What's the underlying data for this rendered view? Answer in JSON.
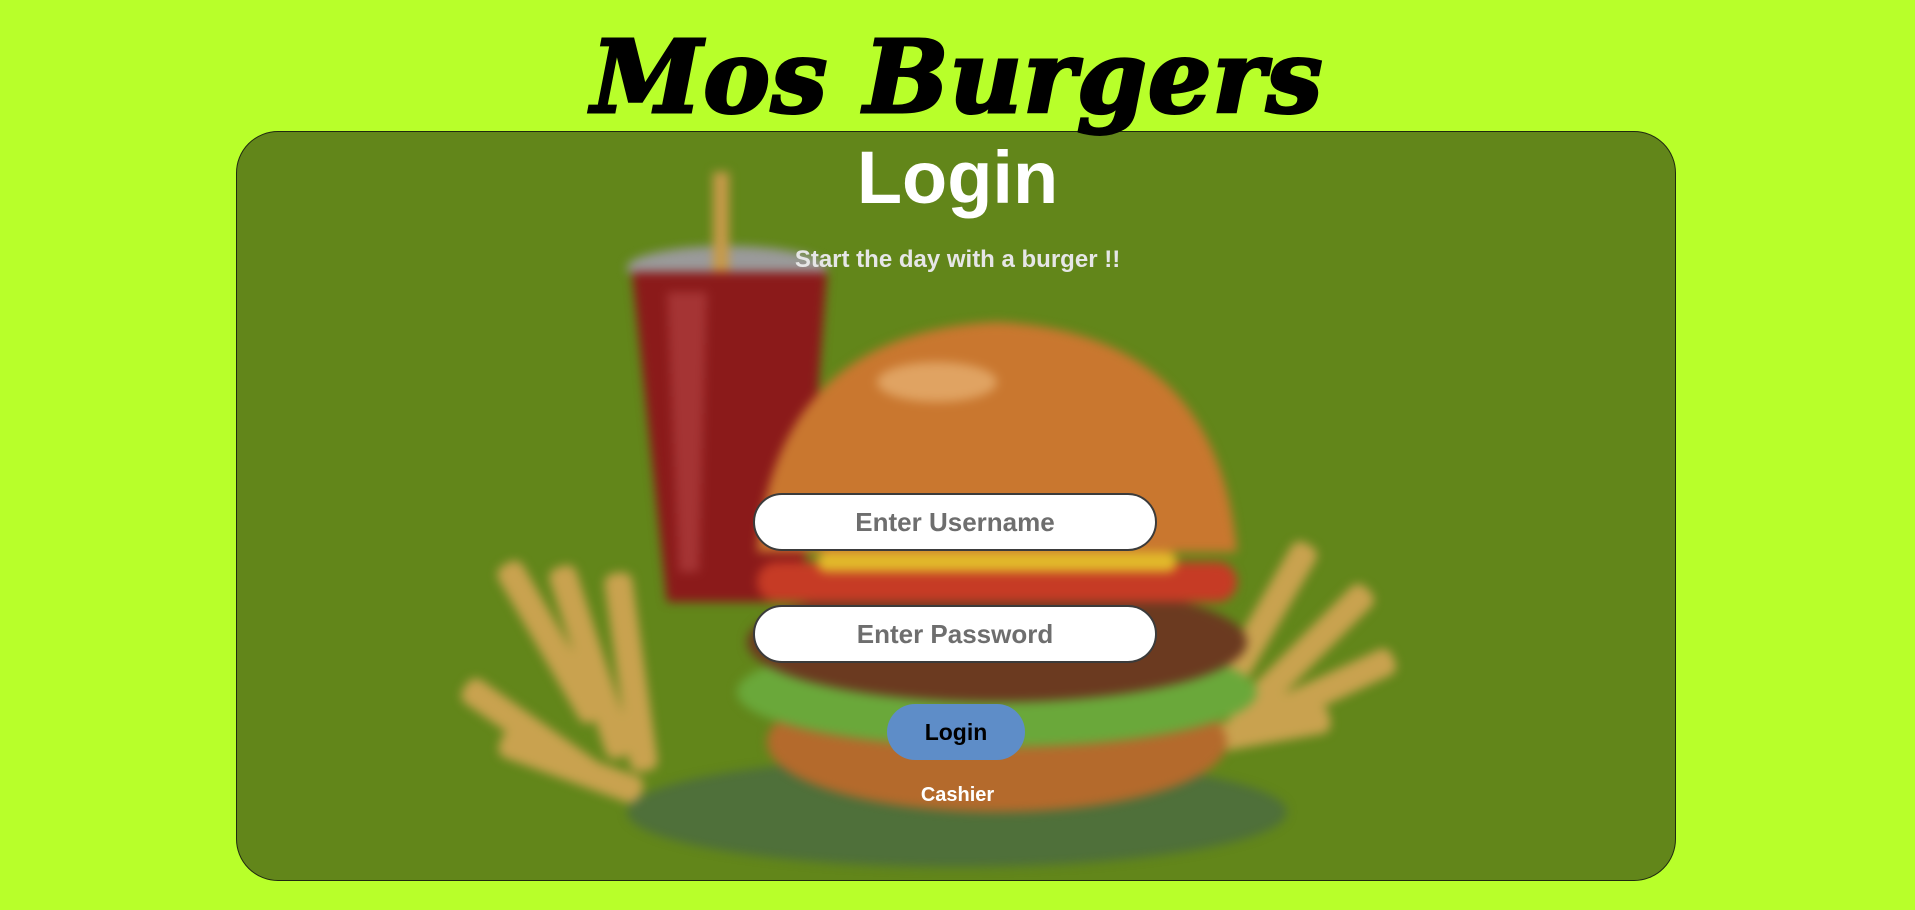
{
  "brand": {
    "name": "Mos Burgers"
  },
  "login": {
    "title": "Login",
    "subtitle": "Start the day with a burger !!",
    "username_placeholder": "Enter Username",
    "password_placeholder": "Enter Password",
    "submit_label": "Login",
    "role_label": "Cashier"
  },
  "colors": {
    "page_background": "#b8ff2a",
    "card_background": "#62861a",
    "button_background": "#5e8dc8",
    "title_text": "#ffffff"
  },
  "hero_image": {
    "icon": "burger-fries-drink-illustration"
  }
}
